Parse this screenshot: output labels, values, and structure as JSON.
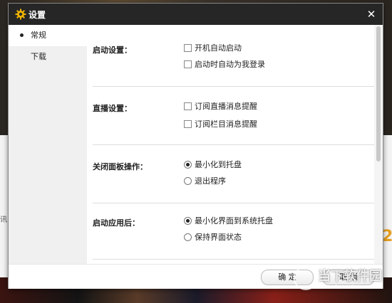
{
  "dialog": {
    "title": "设置",
    "close_symbol": "✕"
  },
  "sidebar": {
    "items": [
      {
        "label": "常规",
        "active": true
      },
      {
        "label": "下载",
        "active": false
      }
    ]
  },
  "sections": {
    "startup": {
      "title": "启动设置：",
      "options": [
        {
          "label": "开机自动启动",
          "checked": false
        },
        {
          "label": "启动时自动为我登录",
          "checked": false
        }
      ]
    },
    "live": {
      "title": "直播设置：",
      "options": [
        {
          "label": "订阅直播消息提醒",
          "checked": false
        },
        {
          "label": "订阅栏目消息提醒",
          "checked": false
        }
      ]
    },
    "close_panel": {
      "title": "关闭面板操作：",
      "options": [
        {
          "label": "最小化到托盘",
          "selected": true
        },
        {
          "label": "退出程序",
          "selected": false
        }
      ]
    },
    "after_start": {
      "title": "启动应用后：",
      "options": [
        {
          "label": "最小化界面到系统托盘",
          "selected": true
        },
        {
          "label": "保持界面状态",
          "selected": false
        }
      ]
    }
  },
  "footer": {
    "ok_label": "确  定",
    "cancel_label": "取  消"
  },
  "background": {
    "side_text": "讯",
    "number": "2"
  },
  "watermark": {
    "name": "当下软件园",
    "url": "www.downxia.com"
  },
  "colors": {
    "titlebar": "#262626",
    "accent_gear": "#f0b400",
    "sidebar_bg": "#f0f0f0"
  },
  "icons": {
    "gear": "gear-icon",
    "close": "close-icon"
  }
}
